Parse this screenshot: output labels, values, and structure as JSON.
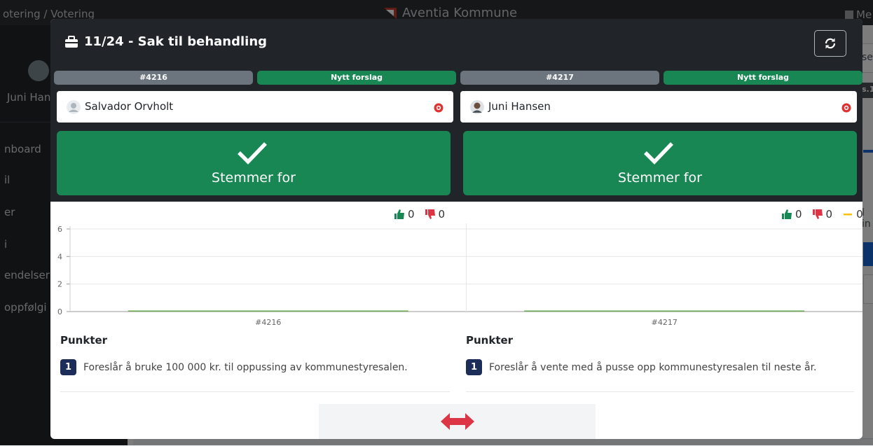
{
  "background": {
    "breadcrumb": "otering / Votering",
    "brand": "Aventia Kommune",
    "top_right": "Me",
    "user_name": "Juni Han",
    "nav": [
      "nboard",
      "il",
      "er",
      "i",
      "endelser",
      "oppfølgi"
    ],
    "main_fragments": [
      "se",
      "s.1",
      "l in"
    ]
  },
  "modal": {
    "title": "11/24 - Sak til behandling",
    "refresh_icon": "refresh-icon",
    "left": {
      "case_id": "#4216",
      "status": "Nytt forslag",
      "voter_name": "Salvador Orvholt",
      "vote_label": "Stemmer for",
      "tally": {
        "for": "0",
        "against": "0"
      },
      "section_title": "Punkter",
      "points": [
        {
          "number": "1",
          "text": "Foreslår å bruke 100 000 kr. til oppussing av kommunestyresalen."
        }
      ]
    },
    "right": {
      "case_id": "#4217",
      "status": "Nytt forslag",
      "voter_name": "Juni Hansen",
      "vote_label": "Stemmer for",
      "tally": {
        "for": "0",
        "against": "0",
        "abstain": "0"
      },
      "section_title": "Punkter",
      "points": [
        {
          "number": "1",
          "text": "Foreslår å vente med å pusse opp kommunestyresalen til neste år."
        }
      ]
    },
    "colors": {
      "for": "#198754",
      "against": "#dc3545",
      "abstain": "#ffc107",
      "badge": "#1c2d5a"
    }
  },
  "chart_data": {
    "type": "bar",
    "categories": [
      "#4216",
      "#4217"
    ],
    "series": [
      {
        "values": [
          0,
          0
        ]
      }
    ],
    "ylim": [
      0,
      6
    ],
    "yticks": [
      "0",
      "2",
      "4",
      "6"
    ],
    "grid": true
  }
}
